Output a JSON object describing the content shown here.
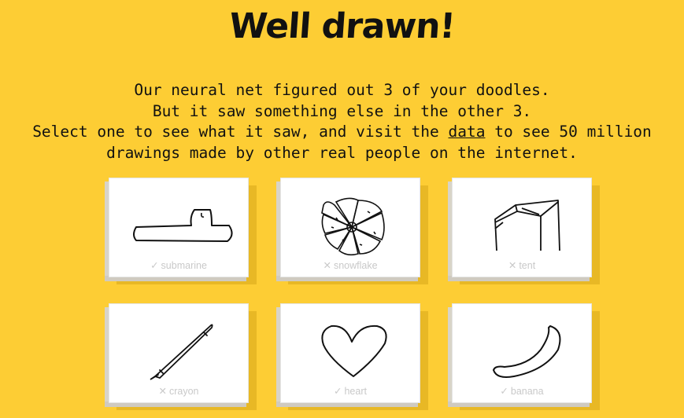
{
  "title": "Well drawn!",
  "message": {
    "line1": "Our neural net figured out 3 of your doodles.",
    "line2": "But it saw something else in the other 3.",
    "line3_before": "Select one to see what it saw, and visit the ",
    "line3_link": "data",
    "line3_after": " to see 50 million",
    "line4": "drawings made by other real people on the internet."
  },
  "cards": [
    {
      "label": "submarine",
      "mark": "✓",
      "recognized": true
    },
    {
      "label": "snowflake",
      "mark": "✕",
      "recognized": false
    },
    {
      "label": "tent",
      "mark": "✕",
      "recognized": false
    },
    {
      "label": "crayon",
      "mark": "✕",
      "recognized": false
    },
    {
      "label": "heart",
      "mark": "✓",
      "recognized": true
    },
    {
      "label": "banana",
      "mark": "✓",
      "recognized": true
    }
  ],
  "colors": {
    "background": "#fdcd34",
    "card": "#ffffff",
    "label": "#c9c9c9"
  }
}
